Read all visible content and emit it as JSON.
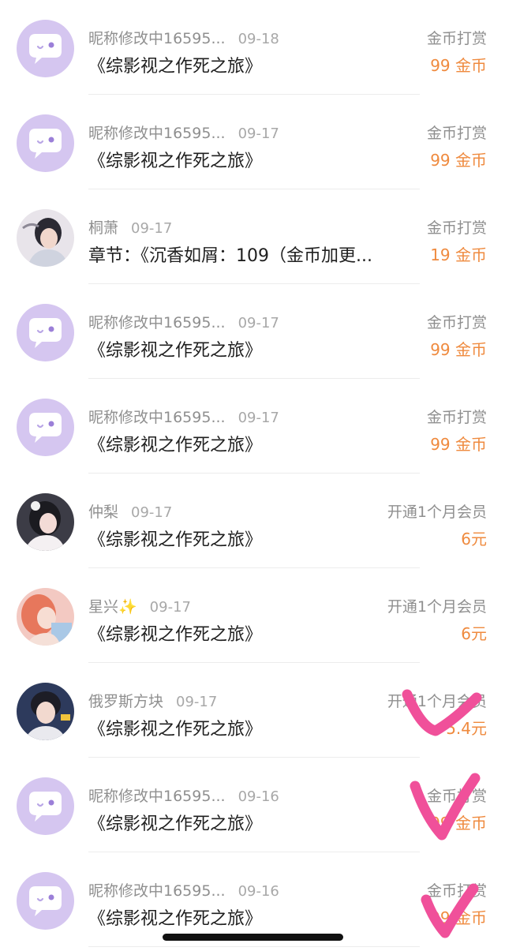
{
  "records": [
    {
      "avatar": "bot",
      "name": "昵称修改中16595...",
      "date": "09-18",
      "title": "《综影视之作死之旅》",
      "type": "金币打赏",
      "amount": "99 金币"
    },
    {
      "avatar": "bot",
      "name": "昵称修改中16595...",
      "date": "09-17",
      "title": "《综影视之作死之旅》",
      "type": "金币打赏",
      "amount": "99 金币"
    },
    {
      "avatar": "photo",
      "name": "桐萧",
      "date": "09-17",
      "title": "章节：《沉香如屑：109（金币加更...",
      "type": "金币打赏",
      "amount": "19 金币"
    },
    {
      "avatar": "bot",
      "name": "昵称修改中16595...",
      "date": "09-17",
      "title": "《综影视之作死之旅》",
      "type": "金币打赏",
      "amount": "99 金币"
    },
    {
      "avatar": "bot",
      "name": "昵称修改中16595...",
      "date": "09-17",
      "title": "《综影视之作死之旅》",
      "type": "金币打赏",
      "amount": "99 金币"
    },
    {
      "avatar": "photo",
      "name": "仲梨",
      "date": "09-17",
      "title": "《综影视之作死之旅》",
      "type": "开通1个月会员",
      "amount": "6元"
    },
    {
      "avatar": "photo",
      "name": "星兴✨",
      "date": "09-17",
      "title": "《综影视之作死之旅》",
      "type": "开通1个月会员",
      "amount": "6元"
    },
    {
      "avatar": "photo",
      "name": "俄罗斯方块",
      "date": "09-17",
      "title": "《综影视之作死之旅》",
      "type": "开通1个月会员",
      "amount": "5.4元"
    },
    {
      "avatar": "bot",
      "name": "昵称修改中16595...",
      "date": "09-16",
      "title": "《综影视之作死之旅》",
      "type": "金币打赏",
      "amount": "99 金币"
    },
    {
      "avatar": "bot",
      "name": "昵称修改中16595...",
      "date": "09-16",
      "title": "《综影视之作死之旅》",
      "type": "金币打赏",
      "amount": "99 金币"
    }
  ],
  "colors": {
    "accent": "#ef8a3e",
    "avatar_bg": "#d5c6f0",
    "check_mark": "#f0509a"
  },
  "icons": {
    "default_avatar": "chat-bubble-face-icon",
    "check_mark": "check-mark-icon"
  }
}
